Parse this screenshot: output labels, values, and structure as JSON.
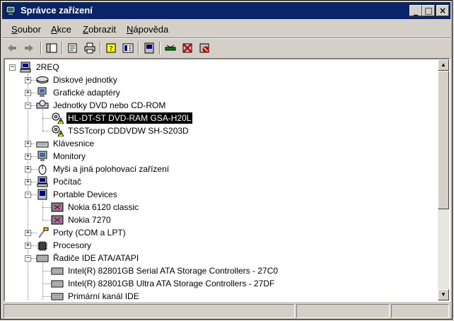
{
  "window": {
    "title": "Správce zařízení",
    "minimize": "_",
    "maximize": "□",
    "close": "×"
  },
  "menu": [
    {
      "key": "S",
      "rest": "oubor"
    },
    {
      "key": "A",
      "rest": "kce"
    },
    {
      "key": "Z",
      "rest": "obrazit"
    },
    {
      "key": "N",
      "rest": "ápověda"
    }
  ],
  "toolbar": {
    "buttons": [
      "back-icon",
      "forward-icon",
      "show-hide-tree-icon",
      "properties-icon",
      "print-icon",
      "help-icon",
      "view-icon",
      "scan-hardware-icon",
      "update-driver-icon",
      "uninstall-icon",
      "disable-icon"
    ]
  },
  "tree": {
    "root": "2REQ",
    "items": [
      {
        "label": "Diskové jednotky",
        "level": 1,
        "exp": "+",
        "icon": "disk-drive-icon"
      },
      {
        "label": "Grafické adaptéry",
        "level": 1,
        "exp": "+",
        "icon": "display-adapter-icon"
      },
      {
        "label": "Jednotky DVD nebo CD-ROM",
        "level": 1,
        "exp": "-",
        "icon": "cdrom-icon"
      },
      {
        "label": "HL-DT-ST DVD-RAM GSA-H20L",
        "level": 2,
        "exp": "",
        "icon": "cdrom-warning-icon",
        "selected": true
      },
      {
        "label": "TSSTcorp CDDVDW SH-S203D",
        "level": 2,
        "exp": "",
        "icon": "cdrom-warning-icon"
      },
      {
        "label": "Klávesnice",
        "level": 1,
        "exp": "+",
        "icon": "keyboard-icon"
      },
      {
        "label": "Monitory",
        "level": 1,
        "exp": "+",
        "icon": "monitor-icon"
      },
      {
        "label": "Myši a jiná polohovací zařízení",
        "level": 1,
        "exp": "+",
        "icon": "mouse-icon"
      },
      {
        "label": "Počítač",
        "level": 1,
        "exp": "+",
        "icon": "computer-icon"
      },
      {
        "label": "Portable Devices",
        "level": 1,
        "exp": "-",
        "icon": "portable-devices-icon"
      },
      {
        "label": "Nokia 6120 classic",
        "level": 2,
        "exp": "",
        "icon": "phone-device-icon"
      },
      {
        "label": "Nokia 7270",
        "level": 2,
        "exp": "",
        "icon": "phone-device-icon"
      },
      {
        "label": "Porty (COM a LPT)",
        "level": 1,
        "exp": "+",
        "icon": "port-icon"
      },
      {
        "label": "Procesory",
        "level": 1,
        "exp": "+",
        "icon": "processor-icon"
      },
      {
        "label": "Řadiče IDE ATA/ATAPI",
        "level": 1,
        "exp": "-",
        "icon": "ide-controller-icon"
      },
      {
        "label": "Intel(R) 82801GB Serial ATA Storage Controllers - 27C0",
        "level": 2,
        "exp": "",
        "icon": "ide-controller-icon"
      },
      {
        "label": "Intel(R) 82801GB Ultra ATA Storage Controllers - 27DF",
        "level": 2,
        "exp": "",
        "icon": "ide-controller-icon"
      },
      {
        "label": "Primární kanál IDE",
        "level": 2,
        "exp": "",
        "icon": "ide-controller-icon"
      }
    ]
  },
  "scroll": {
    "up": "▲",
    "down": "▼"
  },
  "status": [
    "",
    "",
    ""
  ]
}
